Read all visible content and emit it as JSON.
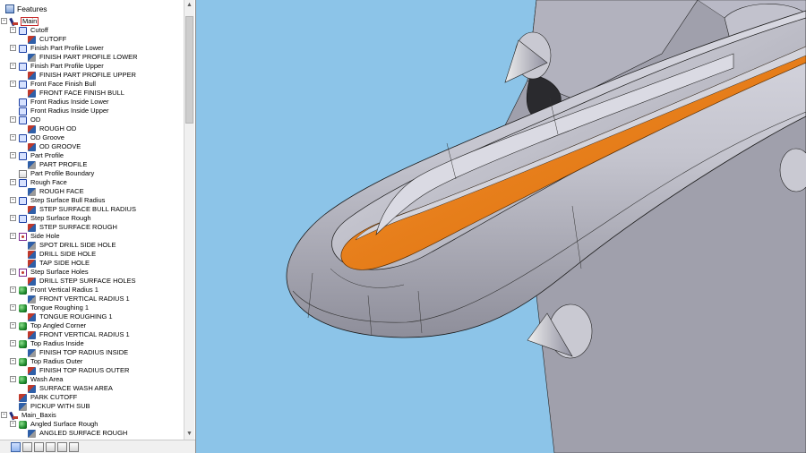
{
  "panel": {
    "title": "Features"
  },
  "tree": [
    {
      "label": "Main",
      "icon": "main-icon",
      "depth": 0,
      "exp": "-",
      "selected": true
    },
    {
      "label": "Cutoff",
      "icon": "group-icon",
      "depth": 1,
      "exp": "-"
    },
    {
      "label": "CUTOFF",
      "icon": "operation-icon",
      "depth": 2
    },
    {
      "label": "Finish Part Profile Lower",
      "icon": "group-icon",
      "depth": 1,
      "exp": "-"
    },
    {
      "label": "FINISH PART PROFILE LOWER",
      "icon": "operation-icon",
      "depth": 2
    },
    {
      "label": "Finish Part Profile Upper",
      "icon": "group-icon",
      "depth": 1,
      "exp": "-"
    },
    {
      "label": "FINISH PART PROFILE UPPER",
      "icon": "operation-icon",
      "depth": 2
    },
    {
      "label": "Front Face Finish Bull",
      "icon": "group-icon",
      "depth": 1,
      "exp": "-"
    },
    {
      "label": "FRONT FACE FINISH BULL",
      "icon": "operation-icon",
      "depth": 2
    },
    {
      "label": "Front Radius Inside Lower",
      "icon": "group-icon",
      "depth": 1
    },
    {
      "label": "Front Radius Inside Upper",
      "icon": "group-icon",
      "depth": 1
    },
    {
      "label": "OD",
      "icon": "group-icon",
      "depth": 1,
      "exp": "-"
    },
    {
      "label": "ROUGH OD",
      "icon": "operation-icon",
      "depth": 2
    },
    {
      "label": "OD Groove",
      "icon": "group-icon",
      "depth": 1,
      "exp": "-"
    },
    {
      "label": "OD GROOVE",
      "icon": "operation-icon",
      "depth": 2
    },
    {
      "label": "Part Profile",
      "icon": "group-icon",
      "depth": 1,
      "exp": "-"
    },
    {
      "label": "PART PROFILE",
      "icon": "operation-icon",
      "depth": 2
    },
    {
      "label": "Part Profile Boundary",
      "icon": "boundary-icon",
      "depth": 1
    },
    {
      "label": "Rough Face",
      "icon": "group-icon",
      "depth": 1,
      "exp": "-"
    },
    {
      "label": "ROUGH FACE",
      "icon": "operation-icon",
      "depth": 2
    },
    {
      "label": "Step Surface Bull Radius",
      "icon": "group-icon",
      "depth": 1,
      "exp": "-"
    },
    {
      "label": "STEP SURFACE BULL RADIUS",
      "icon": "operation-icon",
      "depth": 2
    },
    {
      "label": "Step Surface Rough",
      "icon": "group-icon",
      "depth": 1,
      "exp": "-"
    },
    {
      "label": "STEP SURFACE ROUGH",
      "icon": "operation-icon",
      "depth": 2
    },
    {
      "label": "Side Hole",
      "icon": "hole-icon",
      "depth": 1,
      "exp": "-"
    },
    {
      "label": "SPOT DRILL SIDE HOLE",
      "icon": "operation-icon",
      "depth": 2
    },
    {
      "label": "DRILL SIDE HOLE",
      "icon": "operation-icon",
      "depth": 2
    },
    {
      "label": "TAP SIDE HOLE",
      "icon": "operation-icon",
      "depth": 2
    },
    {
      "label": "Step Surface Holes",
      "icon": "hole-icon",
      "depth": 1,
      "exp": "-"
    },
    {
      "label": "DRILL STEP SURFACE HOLES",
      "icon": "operation-icon",
      "depth": 2
    },
    {
      "label": "Front Vertical Radius 1",
      "icon": "surface-icon",
      "depth": 1,
      "exp": "-"
    },
    {
      "label": "FRONT VERTICAL RADIUS 1",
      "icon": "operation-icon",
      "depth": 2
    },
    {
      "label": "Tongue Roughing 1",
      "icon": "surface-icon",
      "depth": 1,
      "exp": "-"
    },
    {
      "label": "TONGUE ROUGHING 1",
      "icon": "operation-icon",
      "depth": 2
    },
    {
      "label": "Top Angled Corner",
      "icon": "surface-icon",
      "depth": 1,
      "exp": "-"
    },
    {
      "label": "FRONT VERTICAL RADIUS 1",
      "icon": "operation-icon",
      "depth": 2
    },
    {
      "label": "Top Radius Inside",
      "icon": "surface-icon",
      "depth": 1,
      "exp": "-"
    },
    {
      "label": "FINISH TOP RADIUS INSIDE",
      "icon": "operation-icon",
      "depth": 2
    },
    {
      "label": "Top Radius Outer",
      "icon": "surface-icon",
      "depth": 1,
      "exp": "-"
    },
    {
      "label": "FINISH TOP RADIUS OUTER",
      "icon": "operation-icon",
      "depth": 2
    },
    {
      "label": "Wash Area",
      "icon": "surface-icon",
      "depth": 1,
      "exp": "-"
    },
    {
      "label": "SURFACE WASH AREA",
      "icon": "operation-icon",
      "depth": 2
    },
    {
      "label": "PARK CUTOFF",
      "icon": "operation-icon",
      "depth": 1
    },
    {
      "label": "PICKUP WITH SUB",
      "icon": "operation-icon",
      "depth": 1
    },
    {
      "label": "Main_Baxis",
      "icon": "main-icon",
      "depth": 0,
      "exp": "-"
    },
    {
      "label": "Angled Surface Rough",
      "icon": "surface-icon",
      "depth": 1,
      "exp": "-"
    },
    {
      "label": "ANGLED SURFACE ROUGH",
      "icon": "operation-icon",
      "depth": 2
    }
  ],
  "tabs": [
    {
      "name": "features-tab-icon",
      "active": true
    },
    {
      "name": "tools-tab-icon",
      "active": false
    },
    {
      "name": "machining-tab-icon",
      "active": false
    },
    {
      "name": "stock-tab-icon",
      "active": false
    },
    {
      "name": "color-tab-icon",
      "active": false
    },
    {
      "name": "display-tab-icon",
      "active": false
    }
  ],
  "viewport": {
    "background": "#8cc4e8",
    "part_color": "#c3c3cf",
    "housing_color": "#a0a0ac",
    "channel_color": "#f07f14"
  }
}
